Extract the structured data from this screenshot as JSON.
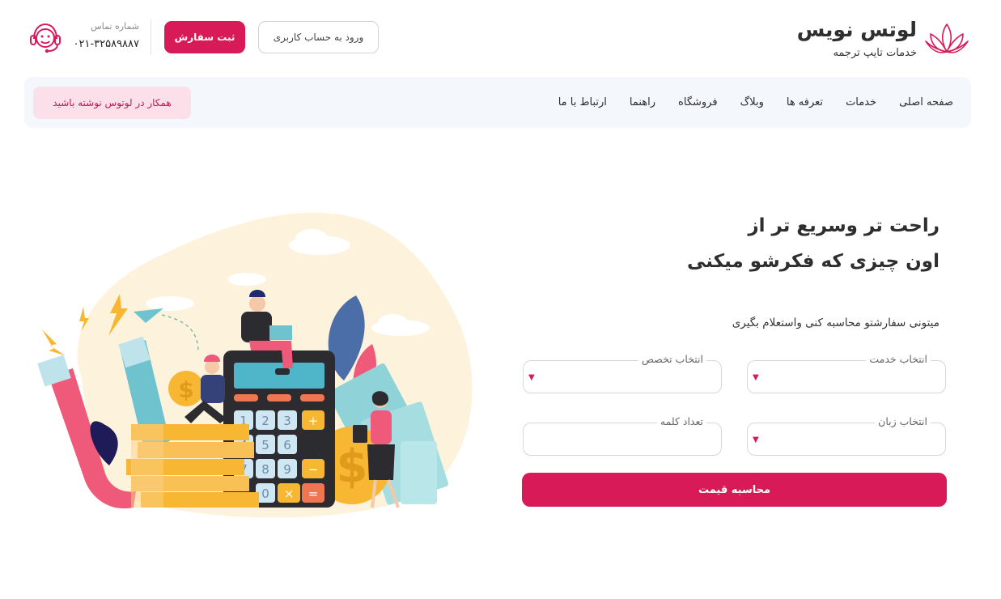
{
  "brand": {
    "name": "لوتس نویس",
    "tagline": "خدمات تایپ ترجمه"
  },
  "header": {
    "login_label": "ورود به حساب کاربری",
    "order_label": "ثبت سفارش",
    "contact_label": "شماره تماس",
    "contact_phone": "۰۲۱-۳۲۵۸۹۸۸۷"
  },
  "nav": {
    "items": [
      {
        "label": "صفحه اصلی"
      },
      {
        "label": "خدمات"
      },
      {
        "label": "تعرفه ها"
      },
      {
        "label": "وبلاگ"
      },
      {
        "label": "فروشگاه"
      },
      {
        "label": "راهنما"
      },
      {
        "label": "ارتباط با ما"
      }
    ],
    "partner_label": "همکار در لوتوس نوشته باشید"
  },
  "hero": {
    "title_line1": "راحت تر وسریع تر از",
    "title_line2": "اون چیزی که فکرشو میکنی",
    "subtitle": "میتونی سفارشتو محاسبه کنی واستعلام بگیری"
  },
  "form": {
    "service_label": "انتخاب خدمت",
    "specialty_label": "انتخاب تخصص",
    "language_label": "انتخاب زبان",
    "word_count_label": "تعداد کلمه",
    "calculate_label": "محاسبه قیمت"
  },
  "calculator_keys": [
    "1",
    "2",
    "3",
    "+",
    "4",
    "5",
    "6",
    "7",
    "8",
    "9",
    "−",
    "0",
    "×",
    "="
  ],
  "colors": {
    "accent": "#d81b58",
    "accent_soft": "#fbe0ea",
    "nav_bg": "#f4f7fc",
    "blob_bg": "#fdf3dc"
  },
  "icons": {
    "brand": "lotus-icon",
    "contact": "headset-support-icon",
    "dropdown": "chevron-down-icon"
  }
}
